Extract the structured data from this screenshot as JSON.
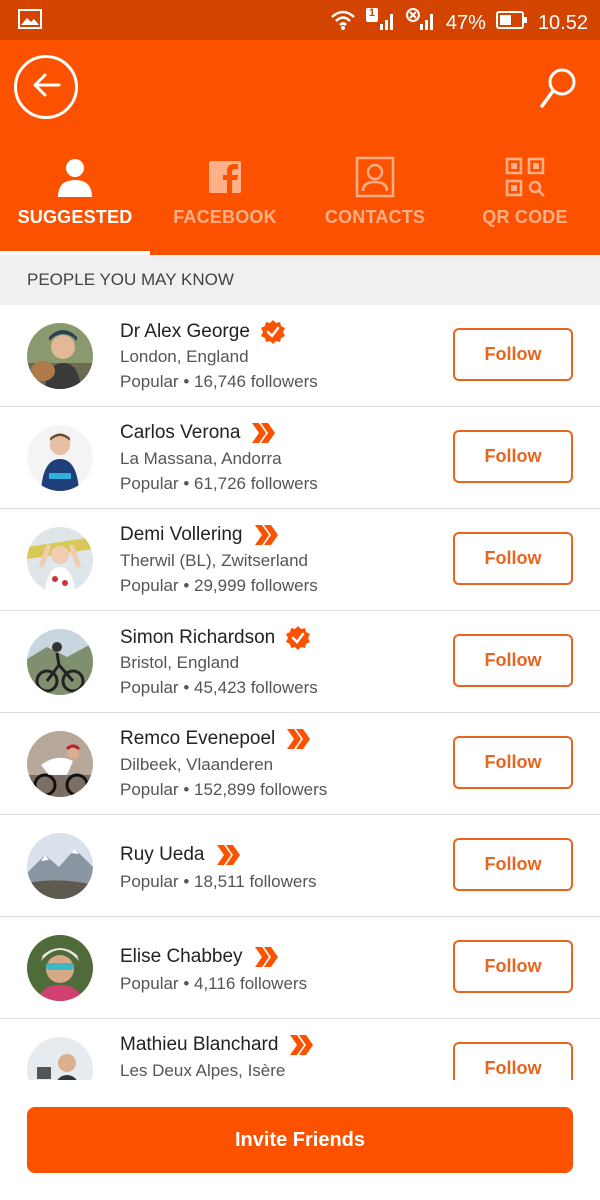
{
  "status_bar": {
    "battery": "47%",
    "time": "10.52",
    "notification_count": "1"
  },
  "tabs": [
    {
      "label": "SUGGESTED",
      "icon": "person-icon",
      "active": true
    },
    {
      "label": "FACEBOOK",
      "icon": "facebook-icon",
      "active": false
    },
    {
      "label": "CONTACTS",
      "icon": "contact-card-icon",
      "active": false
    },
    {
      "label": "QR CODE",
      "icon": "qr-code-icon",
      "active": false
    }
  ],
  "section_title": "PEOPLE YOU MAY KNOW",
  "people": [
    {
      "name": "Dr Alex George",
      "location": "London, England",
      "stats": "Popular • 16,746 followers",
      "badge": "verified",
      "follow_label": "Follow"
    },
    {
      "name": "Carlos Verona",
      "location": "La Massana, Andorra",
      "stats": "Popular • 61,726 followers",
      "badge": "pro",
      "follow_label": "Follow"
    },
    {
      "name": "Demi Vollering",
      "location": "Therwil (BL), Zwitserland",
      "stats": "Popular • 29,999 followers",
      "badge": "pro",
      "follow_label": "Follow"
    },
    {
      "name": "Simon Richardson",
      "location": "Bristol, England",
      "stats": "Popular • 45,423 followers",
      "badge": "verified",
      "follow_label": "Follow"
    },
    {
      "name": "Remco Evenepoel",
      "location": "Dilbeek, Vlaanderen",
      "stats": "Popular • 152,899 followers",
      "badge": "pro",
      "follow_label": "Follow"
    },
    {
      "name": "Ruy Ueda",
      "location": "",
      "stats": "Popular • 18,511 followers",
      "badge": "pro",
      "follow_label": "Follow"
    },
    {
      "name": "Elise Chabbey",
      "location": "",
      "stats": "Popular • 4,116 followers",
      "badge": "pro",
      "follow_label": "Follow"
    },
    {
      "name": "Mathieu Blanchard",
      "location": "Les Deux Alpes, Isère",
      "stats": "",
      "badge": "pro",
      "follow_label": "Follow"
    }
  ],
  "invite_label": "Invite Friends",
  "colors": {
    "brand": "#fc5200",
    "status_bar": "#d24400",
    "follow_outline": "#e8651f"
  }
}
